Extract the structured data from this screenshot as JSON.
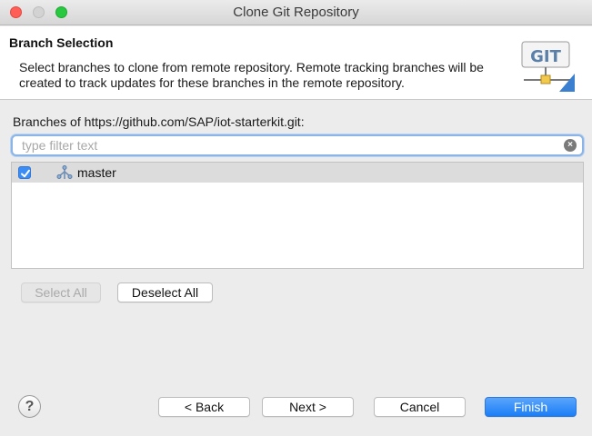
{
  "window": {
    "title": "Clone Git Repository"
  },
  "banner": {
    "title": "Branch Selection",
    "description": "Select branches to clone from remote repository. Remote tracking branches will be created to track updates for these branches in the remote repository.",
    "logo_text": "GIT"
  },
  "content": {
    "branches_label": "Branches of https://github.com/SAP/iot-starterkit.git:",
    "filter": {
      "placeholder": "type filter text",
      "value": ""
    },
    "branches": [
      {
        "label": "master",
        "checked": true
      }
    ]
  },
  "buttons": {
    "select_all": "Select All",
    "deselect_all": "Deselect All",
    "back": "< Back",
    "next": "Next >",
    "cancel": "Cancel",
    "finish": "Finish",
    "help": "?"
  },
  "colors": {
    "accent": "#1b7ef6",
    "close": "#ff5f57",
    "maximize": "#28c840"
  }
}
